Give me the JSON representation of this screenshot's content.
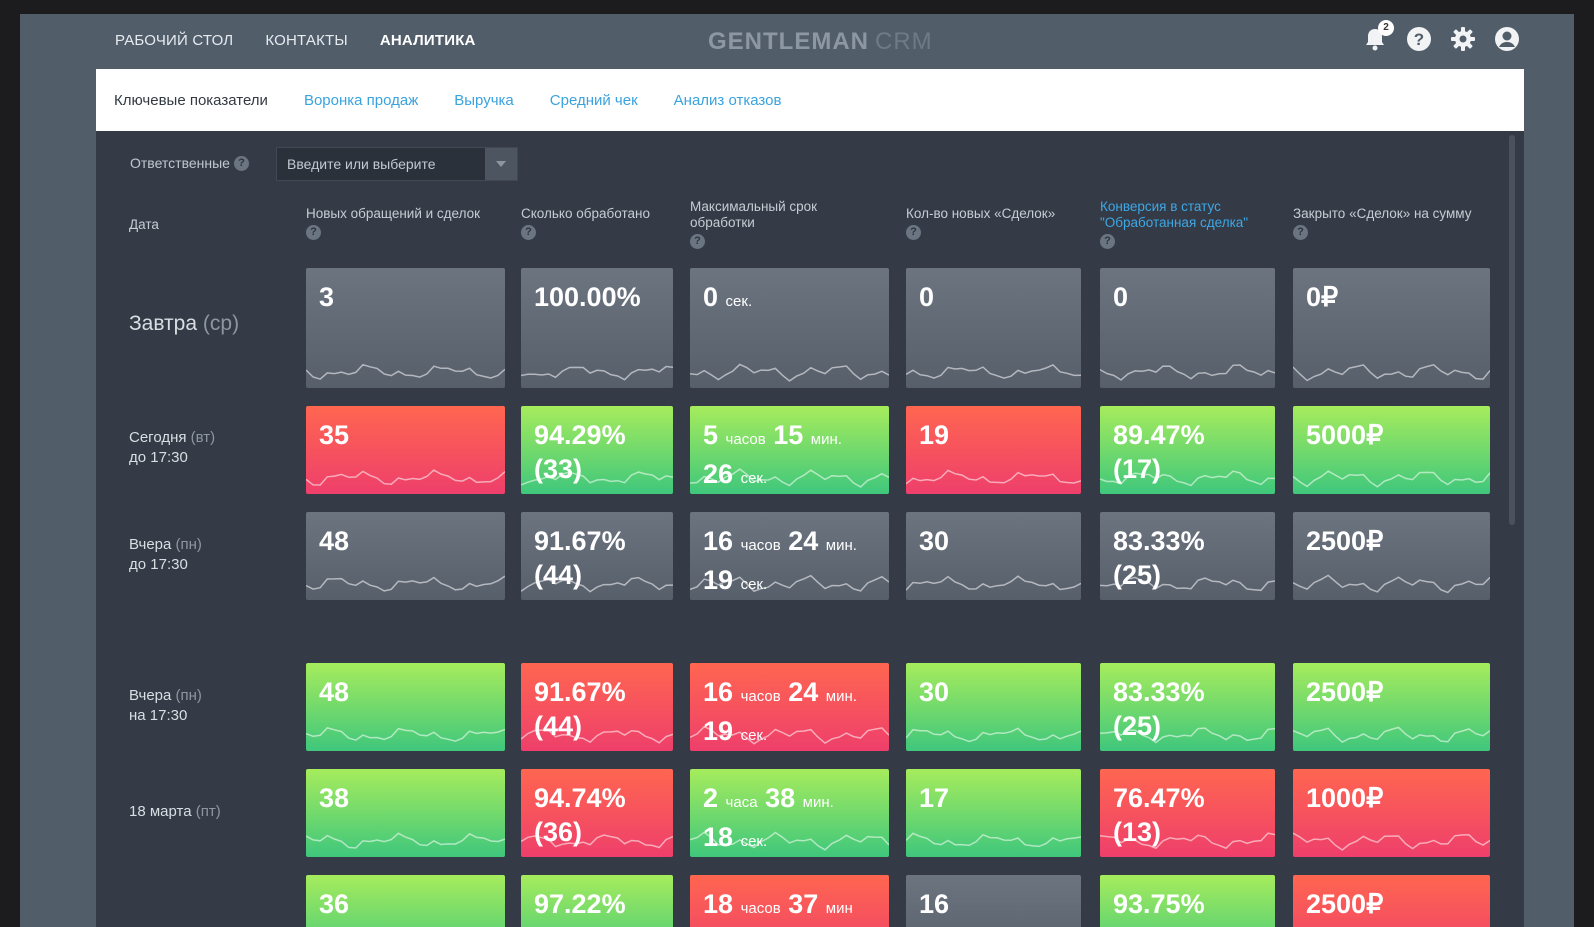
{
  "topnav": [
    {
      "label": "РАБОЧИЙ СТОЛ",
      "active": false
    },
    {
      "label": "КОНТАКТЫ",
      "active": false
    },
    {
      "label": "АНАЛИТИКА",
      "active": true
    }
  ],
  "logo": {
    "main": "GENTLEMAN",
    "suffix": "CRM"
  },
  "notifications": {
    "count": "2"
  },
  "icons": [
    "bell-icon",
    "help-icon",
    "gear-icon",
    "user-icon"
  ],
  "subnav": [
    {
      "label": "Ключевые показатели",
      "active": true
    },
    {
      "label": "Воронка продаж",
      "active": false
    },
    {
      "label": "Выручка",
      "active": false
    },
    {
      "label": "Средний чек",
      "active": false
    },
    {
      "label": "Анализ отказов",
      "active": false
    }
  ],
  "filter": {
    "label": "Ответственные",
    "placeholder": "Введите или выберите"
  },
  "columns": {
    "date": "Дата",
    "c1": "Новых обращений и сделок",
    "c2": "Сколько обработано",
    "c3": "Максимальный срок обработки",
    "c4": "Кол-во новых «Сделок»",
    "c5": "Конверсия в статус \"Обработанная сделка\"",
    "c6": "Закрыто «Сделок» на сумму"
  },
  "colors": {
    "red": "#f4515f",
    "green": "#6fdc6c",
    "gray": "#616976",
    "accent": "#3ea7e4"
  },
  "rows": [
    {
      "label": "Завтра",
      "muted": "(ср)",
      "sub": "",
      "cells": [
        {
          "state": "gray",
          "v1": "3"
        },
        {
          "state": "gray",
          "v1": "100.00%"
        },
        {
          "state": "gray",
          "v1": "0",
          "u1": "сек."
        },
        {
          "state": "gray",
          "v1": "0"
        },
        {
          "state": "gray",
          "v1": "0"
        },
        {
          "state": "gray",
          "v1": "0₽"
        }
      ]
    },
    {
      "label": "Сегодня",
      "muted": "(вт)",
      "sub": "до 17:30",
      "cells": [
        {
          "state": "red",
          "v1": "35"
        },
        {
          "state": "green",
          "v1": "94.29%",
          "v4": "(33)"
        },
        {
          "state": "green",
          "v1": "5",
          "u1": "часов",
          "v2": "15",
          "u2": "мин.",
          "v3": "26",
          "u3": "сек."
        },
        {
          "state": "red",
          "v1": "19"
        },
        {
          "state": "green",
          "v1": "89.47%",
          "v4": "(17)"
        },
        {
          "state": "green",
          "v1": "5000₽"
        }
      ]
    },
    {
      "label": "Вчера",
      "muted": "(пн)",
      "sub": "до 17:30",
      "cells": [
        {
          "state": "gray",
          "v1": "48"
        },
        {
          "state": "gray",
          "v1": "91.67%",
          "v4": "(44)"
        },
        {
          "state": "gray",
          "v1": "16",
          "u1": "часов",
          "v2": "24",
          "u2": "мин.",
          "v3": "19",
          "u3": "сек."
        },
        {
          "state": "gray",
          "v1": "30"
        },
        {
          "state": "gray",
          "v1": "83.33%",
          "v4": "(25)"
        },
        {
          "state": "gray",
          "v1": "2500₽"
        }
      ]
    },
    {
      "label": "Вчера",
      "muted": "(пн)",
      "sub": "на 17:30",
      "cells": [
        {
          "state": "green",
          "v1": "48"
        },
        {
          "state": "red",
          "v1": "91.67%",
          "v4": "(44)"
        },
        {
          "state": "red",
          "v1": "16",
          "u1": "часов",
          "v2": "24",
          "u2": "мин.",
          "v3": "19",
          "u3": "сек."
        },
        {
          "state": "green",
          "v1": "30"
        },
        {
          "state": "green",
          "v1": "83.33%",
          "v4": "(25)"
        },
        {
          "state": "green",
          "v1": "2500₽"
        }
      ]
    },
    {
      "label": "18 марта",
      "muted": "(пт)",
      "sub": "",
      "cells": [
        {
          "state": "green",
          "v1": "38"
        },
        {
          "state": "red",
          "v1": "94.74%",
          "v4": "(36)"
        },
        {
          "state": "green",
          "v1": "2",
          "u1": "часа",
          "v2": "38",
          "u2": "мин.",
          "v3": "18",
          "u3": "сек."
        },
        {
          "state": "green",
          "v1": "17"
        },
        {
          "state": "red",
          "v1": "76.47%",
          "v4": "(13)"
        },
        {
          "state": "red",
          "v1": "1000₽"
        }
      ]
    },
    {
      "label": "",
      "muted": "",
      "sub": "",
      "cells": [
        {
          "state": "green",
          "v1": "36"
        },
        {
          "state": "green",
          "v1": "97.22%"
        },
        {
          "state": "red",
          "v1": "18",
          "u1": "часов",
          "v2": "37",
          "u2": "мин"
        },
        {
          "state": "gray",
          "v1": "16"
        },
        {
          "state": "green",
          "v1": "93.75%"
        },
        {
          "state": "red",
          "v1": "2500₽"
        }
      ]
    }
  ]
}
